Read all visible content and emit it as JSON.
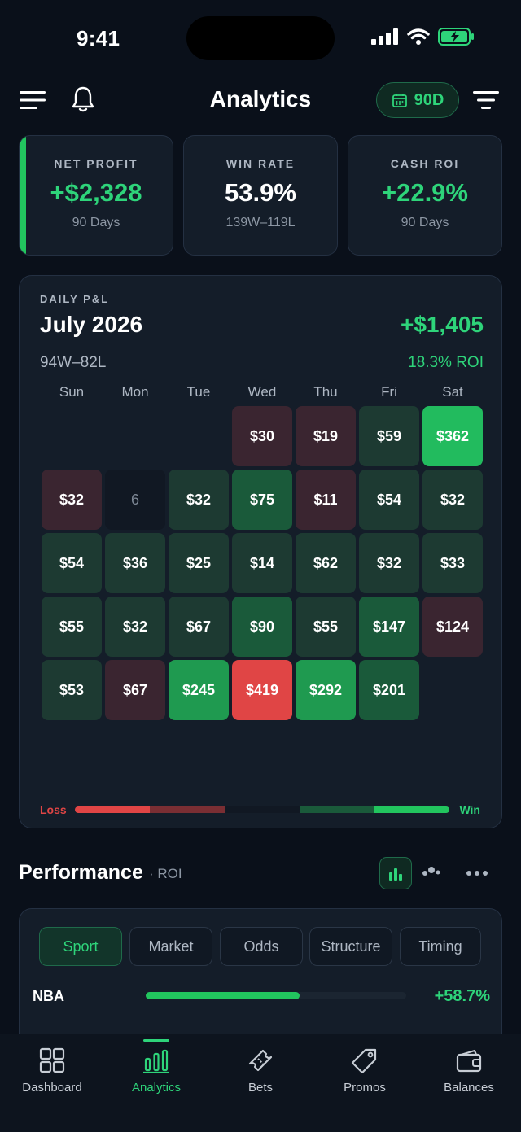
{
  "status_bar": {
    "time": "9:41"
  },
  "header": {
    "title": "Analytics",
    "range_label": "90D"
  },
  "kpis": [
    {
      "label": "NET PROFIT",
      "value": "+$2,328",
      "sub": "90 Days"
    },
    {
      "label": "WIN RATE",
      "value": "53.9%",
      "sub": "139W–119L"
    },
    {
      "label": "CASH ROI",
      "value": "+22.9%",
      "sub": "90 Days"
    }
  ],
  "calendar": {
    "kicker": "DAILY P&L",
    "month": "July 2026",
    "record": "94W–82L",
    "total": "+$1,405",
    "roi": "18.3% ROI",
    "weekdays": [
      "Sun",
      "Mon",
      "Tue",
      "Wed",
      "Thu",
      "Fri",
      "Sat"
    ],
    "weeks": [
      [
        null,
        null,
        null,
        {
          "v": "$30",
          "t": "loss",
          "l": 1
        },
        {
          "v": "$19",
          "t": "loss",
          "l": 1
        },
        {
          "v": "$59",
          "t": "win",
          "l": 1
        },
        {
          "v": "$362",
          "t": "win",
          "l": 4
        }
      ],
      [
        {
          "v": "$32",
          "t": "loss",
          "l": 1
        },
        {
          "v": "6",
          "t": "none",
          "l": 0
        },
        {
          "v": "$32",
          "t": "win",
          "l": 1
        },
        {
          "v": "$75",
          "t": "win",
          "l": 2
        },
        {
          "v": "$11",
          "t": "loss",
          "l": 1
        },
        {
          "v": "$54",
          "t": "win",
          "l": 1
        },
        {
          "v": "$32",
          "t": "win",
          "l": 1
        }
      ],
      [
        {
          "v": "$54",
          "t": "win",
          "l": 1
        },
        {
          "v": "$36",
          "t": "win",
          "l": 1
        },
        {
          "v": "$25",
          "t": "win",
          "l": 1
        },
        {
          "v": "$14",
          "t": "win",
          "l": 1
        },
        {
          "v": "$62",
          "t": "win",
          "l": 1
        },
        {
          "v": "$32",
          "t": "win",
          "l": 1
        },
        {
          "v": "$33",
          "t": "win",
          "l": 1
        }
      ],
      [
        {
          "v": "$55",
          "t": "win",
          "l": 1
        },
        {
          "v": "$32",
          "t": "win",
          "l": 1
        },
        {
          "v": "$67",
          "t": "win",
          "l": 1
        },
        {
          "v": "$90",
          "t": "win",
          "l": 2
        },
        {
          "v": "$55",
          "t": "win",
          "l": 1
        },
        {
          "v": "$147",
          "t": "win",
          "l": 2
        },
        {
          "v": "$124",
          "t": "loss",
          "l": 2
        }
      ],
      [
        {
          "v": "$53",
          "t": "win",
          "l": 1
        },
        {
          "v": "$67",
          "t": "loss",
          "l": 1
        },
        {
          "v": "$245",
          "t": "win",
          "l": 3
        },
        {
          "v": "$419",
          "t": "loss",
          "l": 3
        },
        {
          "v": "$292",
          "t": "win",
          "l": 3
        },
        {
          "v": "$201",
          "t": "win",
          "l": 2
        },
        null
      ]
    ],
    "legend": {
      "loss": "Loss",
      "win": "Win"
    }
  },
  "performance": {
    "title": "Performance",
    "subtitle": "· ROI",
    "segments": [
      "Sport",
      "Market",
      "Odds",
      "Structure",
      "Timing"
    ],
    "active_segment": "Sport",
    "rows": [
      {
        "label": "NBA",
        "value": "+58.7%",
        "fill": 0.59
      }
    ]
  },
  "tabbar": {
    "items": [
      {
        "label": "Dashboard",
        "icon": "grid-icon"
      },
      {
        "label": "Analytics",
        "icon": "bar-chart-icon"
      },
      {
        "label": "Bets",
        "icon": "ticket-icon"
      },
      {
        "label": "Promos",
        "icon": "tag-icon"
      },
      {
        "label": "Balances",
        "icon": "wallet-icon"
      }
    ],
    "active": "Analytics"
  },
  "colors": {
    "accent": "#2ed47a",
    "loss": "#e04545",
    "card": "#141d29",
    "background": "#0a101a"
  }
}
